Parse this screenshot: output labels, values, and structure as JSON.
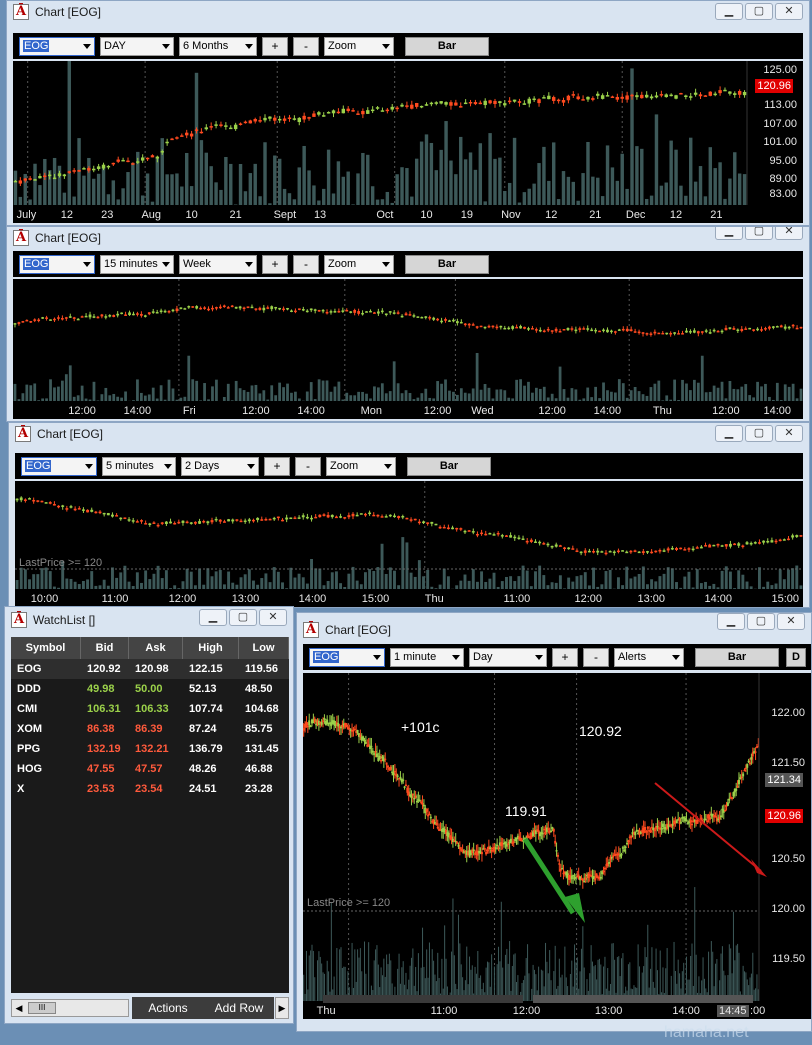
{
  "windows": {
    "w1": {
      "title": "Chart [EOG]",
      "symbol": "EOG",
      "interval": "DAY",
      "range": "6 Months",
      "zoom": "Zoom",
      "bar": "Bar",
      "price": "120.96",
      "xlabels": [
        "July",
        "12",
        "23",
        "Aug",
        "10",
        "21",
        "Sept",
        "13",
        "Oct",
        "10",
        "19",
        "Nov",
        "12",
        "21",
        "Dec",
        "12",
        "21"
      ],
      "ylabels": [
        "125.00",
        "113.00",
        "107.00",
        "101.00",
        "95.00",
        "89.00",
        "83.00"
      ]
    },
    "w2": {
      "title": "Chart [EOG]",
      "symbol": "EOG",
      "interval": "15 minutes",
      "range": "Week",
      "zoom": "Zoom",
      "bar": "Bar",
      "xlabels": [
        "12:00",
        "14:00",
        "Fri",
        "12:00",
        "14:00",
        "Mon",
        "12:00",
        "Wed",
        "12:00",
        "14:00",
        "Thu",
        "12:00",
        "14:00"
      ]
    },
    "w3": {
      "title": "Chart [EOG]",
      "symbol": "EOG",
      "interval": "5 minutes",
      "range": "2 Days",
      "zoom": "Zoom",
      "bar": "Bar",
      "alert": "LastPrice >= 120",
      "xlabels": [
        "10:00",
        "11:00",
        "12:00",
        "13:00",
        "14:00",
        "15:00",
        "Thu",
        "11:00",
        "12:00",
        "13:00",
        "14:00",
        "15:00"
      ]
    },
    "w4": {
      "title": "Chart [EOG]",
      "symbol": "EOG",
      "interval": "1 minute",
      "range": "Day",
      "alerts": "Alerts",
      "bar": "Bar",
      "extra": "D",
      "alert": "LastPrice >= 120",
      "annotations": {
        "change": "+101c",
        "high": "120.92",
        "low": "119.91"
      },
      "price_red": "120.96",
      "price_gray": "121.34",
      "bottom_red": "120.96",
      "ylabels": [
        "122.00",
        "121.50",
        "120.50",
        "120.00",
        "119.50"
      ],
      "xlabels": [
        "Thu",
        "11:00",
        "12:00",
        "13:00",
        "14:00"
      ],
      "time_tag": "14:45",
      "time_tag_tail": ":00"
    }
  },
  "watchlist": {
    "title": "WatchList []",
    "columns": [
      "Symbol",
      "Bid",
      "Ask",
      "High",
      "Low"
    ],
    "rows": [
      {
        "symbol": "EOG",
        "bid": "120.92",
        "ask": "120.98",
        "high": "122.15",
        "low": "119.56",
        "color": "w"
      },
      {
        "symbol": "DDD",
        "bid": "49.98",
        "ask": "50.00",
        "high": "52.13",
        "low": "48.50",
        "color": "g"
      },
      {
        "symbol": "CMI",
        "bid": "106.31",
        "ask": "106.33",
        "high": "107.74",
        "low": "104.68",
        "color": "g"
      },
      {
        "symbol": "XOM",
        "bid": "86.38",
        "ask": "86.39",
        "high": "87.24",
        "low": "85.75",
        "color": "r"
      },
      {
        "symbol": "PPG",
        "bid": "132.19",
        "ask": "132.21",
        "high": "136.79",
        "low": "131.45",
        "color": "r"
      },
      {
        "symbol": "HOG",
        "bid": "47.55",
        "ask": "47.57",
        "high": "48.26",
        "low": "46.88",
        "color": "r"
      },
      {
        "symbol": "X",
        "bid": "23.53",
        "ask": "23.54",
        "high": "24.51",
        "low": "23.28",
        "color": "r"
      }
    ],
    "actions": "Actions",
    "add_row": "Add Row",
    "scroll_grip": "III"
  },
  "watermark": "hamaha.net",
  "colors": {
    "up": "#9bd14a",
    "down": "#ff4a1f",
    "volume": "#3a5a5a",
    "price_tag": "#e00000"
  }
}
